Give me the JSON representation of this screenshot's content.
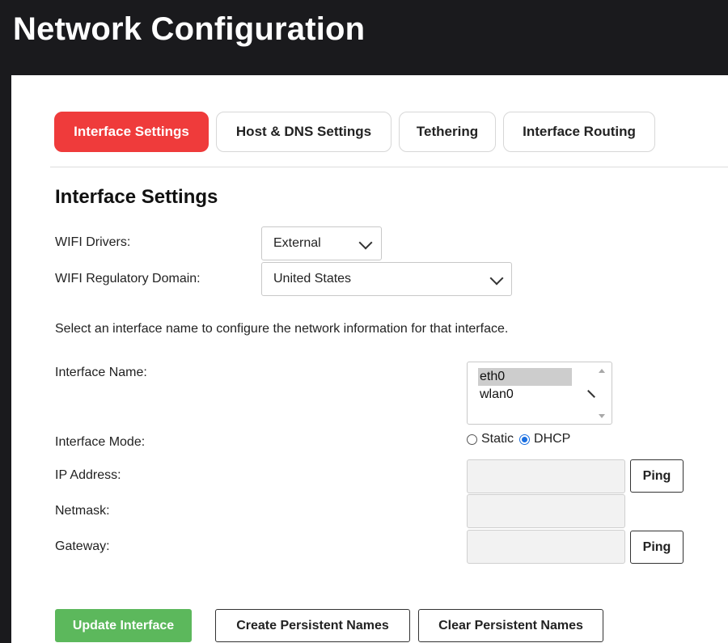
{
  "header": {
    "title": "Network Configuration"
  },
  "tabs": [
    {
      "label": "Interface Settings",
      "active": true
    },
    {
      "label": "Host & DNS Settings",
      "active": false
    },
    {
      "label": "Tethering",
      "active": false
    },
    {
      "label": "Interface Routing",
      "active": false
    }
  ],
  "section": {
    "title": "Interface Settings"
  },
  "wifi_drivers": {
    "label": "WIFI Drivers:",
    "value": "External"
  },
  "wifi_domain": {
    "label": "WIFI Regulatory Domain:",
    "value": "United States"
  },
  "help_text": "Select an interface name to configure the network information for that interface.",
  "interface_name": {
    "label": "Interface Name:",
    "options": [
      "eth0",
      "wlan0"
    ],
    "selected": "eth0"
  },
  "interface_mode": {
    "label": "Interface Mode:",
    "options": [
      "Static",
      "DHCP"
    ],
    "selected": "DHCP"
  },
  "ip_address": {
    "label": "IP Address:",
    "value": "",
    "ping_label": "Ping"
  },
  "netmask": {
    "label": "Netmask:",
    "value": ""
  },
  "gateway": {
    "label": "Gateway:",
    "value": "",
    "ping_label": "Ping"
  },
  "actions": {
    "update": "Update Interface",
    "create": "Create Persistent Names",
    "clear": "Clear Persistent Names"
  },
  "colors": {
    "header_bg": "#1a1a1d",
    "active_tab": "#ef3b3b",
    "update_button": "#5cb85c",
    "radio_accent": "#1a6fe0"
  }
}
